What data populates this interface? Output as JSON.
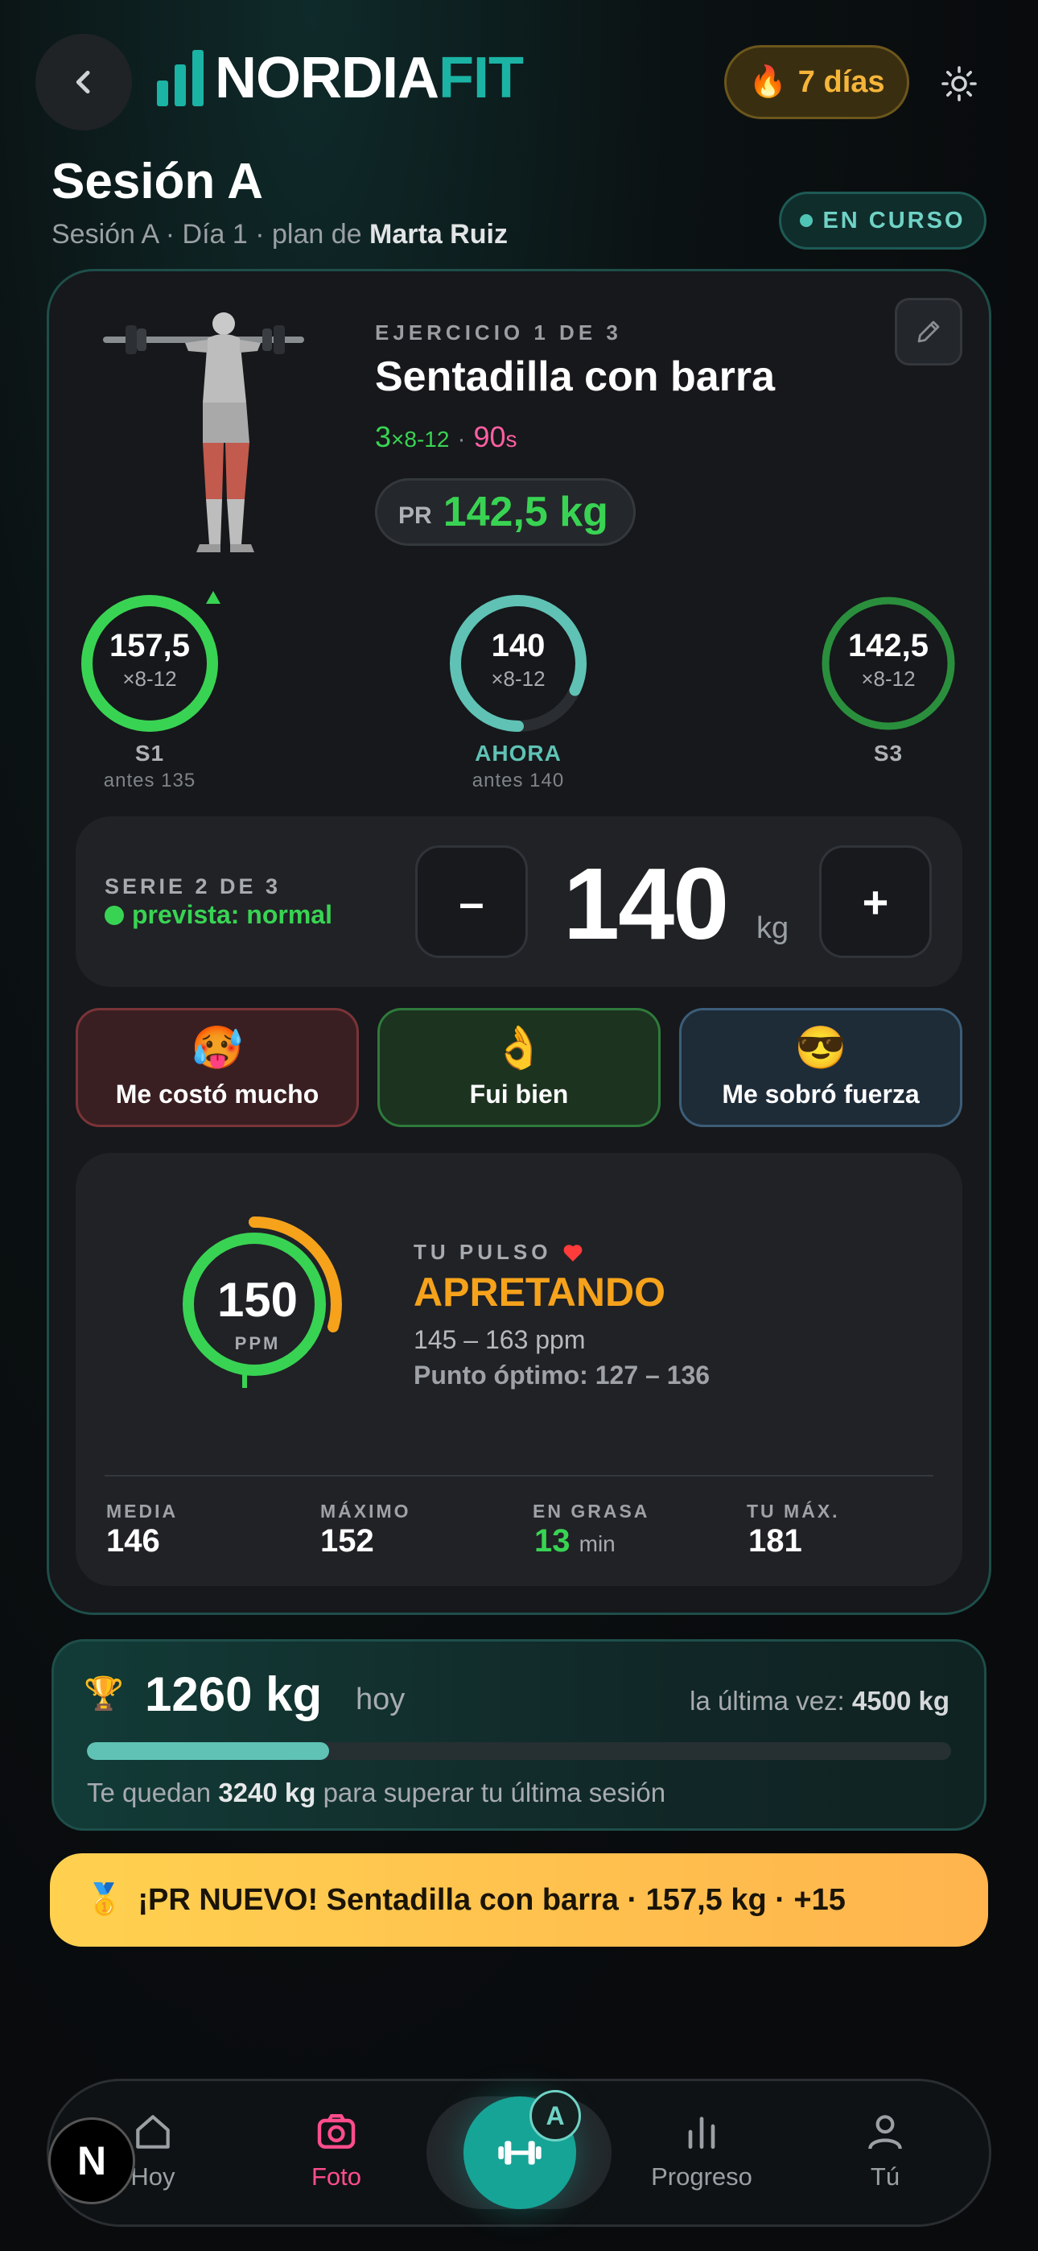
{
  "header": {
    "logo_part1": "NORDIA",
    "logo_part2": "FIT",
    "streak_emoji": "🔥",
    "streak_label": "7 días"
  },
  "session": {
    "title": "Sesión A",
    "subtitle_prefix": "Sesión A · Día 1 · plan de ",
    "coach": "Marta Ruiz",
    "status": "EN CURSO"
  },
  "exercise": {
    "counter": "EJERCICIO 1 DE 3",
    "name": "Sentadilla con barra",
    "sets": "3",
    "reps": "×8-12",
    "rest_value": "90",
    "rest_unit": "s",
    "pr_label": "PR",
    "pr_value": "142,5 kg"
  },
  "set_rings": [
    {
      "value": "157,5",
      "reps": "×8-12",
      "label": "S1",
      "previous": "antes 135",
      "progress": 1.0,
      "color": "#39d353"
    },
    {
      "value": "140",
      "reps": "×8-12",
      "label": "AHORA",
      "previous": "antes 140",
      "progress": 0.82,
      "color": "#5fc2b5"
    },
    {
      "value": "142,5",
      "reps": "×8-12",
      "label": "S3",
      "previous": "",
      "progress": 1.0,
      "color": "#2a8f3c"
    }
  ],
  "current_set": {
    "label": "SERIE 2 DE 3",
    "forecast": "prevista: normal",
    "minus": "–",
    "plus": "+",
    "weight": "140",
    "unit": "kg"
  },
  "feel_options": [
    {
      "emoji": "🥵",
      "label": "Me costó mucho"
    },
    {
      "emoji": "👌",
      "label": "Fui bien"
    },
    {
      "emoji": "😎",
      "label": "Me sobró fuerza"
    }
  ],
  "pulse": {
    "label": "TU PULSO",
    "bpm": "150",
    "bpm_unit": "PPM",
    "state": "APRETANDO",
    "range": "145 – 163 ppm",
    "optimal": "Punto óptimo: 127 – 136",
    "stats": [
      {
        "label": "MEDIA",
        "value": "146",
        "unit": ""
      },
      {
        "label": "MÁXIMO",
        "value": "152",
        "unit": ""
      },
      {
        "label": "EN GRASA",
        "value": "13",
        "unit": "min"
      },
      {
        "label": "TU MÁX.",
        "value": "181",
        "unit": ""
      }
    ]
  },
  "volume": {
    "icon": "🏆",
    "value": "1260 kg",
    "today": "hoy",
    "last_label": "la última vez: ",
    "last_value": "4500 kg",
    "progress": 0.28,
    "remaining_prefix": "Te quedan ",
    "remaining_value": "3240 kg",
    "remaining_suffix": " para superar tu última sesión"
  },
  "toast": {
    "icon": "🥇",
    "text": "¡PR NUEVO! Sentadilla con barra · 157,5 kg · +15"
  },
  "nav": {
    "items": [
      "Hoy",
      "Foto",
      "Progreso",
      "Tú"
    ],
    "center_badge": "A",
    "active_color": "#ff4d8d"
  },
  "corner_badge": "N"
}
